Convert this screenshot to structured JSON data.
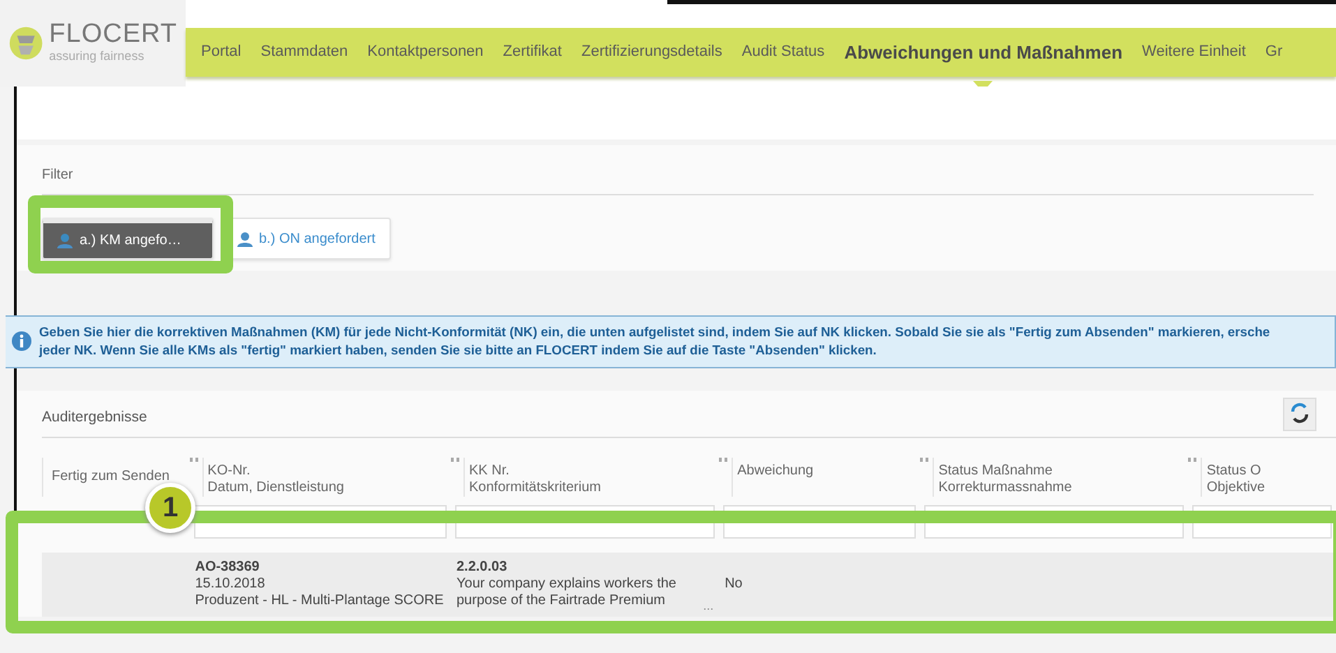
{
  "logo": {
    "name": "FLOCERT",
    "tagline": "assuring fairness"
  },
  "nav": [
    {
      "label": "Portal",
      "selected": false
    },
    {
      "label": "Stammdaten",
      "selected": false
    },
    {
      "label": "Kontaktpersonen",
      "selected": false
    },
    {
      "label": "Zertifikat",
      "selected": false
    },
    {
      "label": "Zertifizierungsdetails",
      "selected": false
    },
    {
      "label": "Audit Status",
      "selected": false
    },
    {
      "label": "Abweichungen und Maßnahmen",
      "selected": true
    },
    {
      "label": "Weitere Einheit",
      "selected": false
    },
    {
      "label": "Gr",
      "selected": false
    }
  ],
  "filter": {
    "title": "Filter",
    "buttons": [
      {
        "label": "a.) KM angefo…",
        "selected": true,
        "highlighted": true
      },
      {
        "label": "b.) ON angefordert",
        "selected": false,
        "highlighted": false
      }
    ]
  },
  "info": [
    "Geben Sie hier die korrektiven Maßnahmen (KM) für jede Nicht-Konformität (NK) ein, die unten aufgelistet sind, indem Sie auf NK klicken. Sobald Sie sie als \"Fertig zum Absenden\" markieren, ersche",
    "jeder NK. Wenn Sie alle KMs als \"fertig\" markiert haben, senden Sie sie bitte an FLOCERT indem Sie auf die Taste \"Absenden\" klicken."
  ],
  "results": {
    "title": "Auditergebnisse",
    "columns": [
      {
        "lines": [
          "Fertig zum Senden"
        ],
        "sortable": false,
        "filterable": false
      },
      {
        "lines": [
          "KO-Nr.",
          "Datum, Dienstleistung"
        ],
        "sortable": true,
        "filterable": true
      },
      {
        "lines": [
          "KK Nr.",
          "Konformitätskriterium"
        ],
        "sortable": true,
        "filterable": true
      },
      {
        "lines": [
          "Abweichung"
        ],
        "sortable": true,
        "filterable": true
      },
      {
        "lines": [
          "Status Maßnahme",
          "Korrekturmassnahme"
        ],
        "sortable": true,
        "filterable": true
      },
      {
        "lines": [
          "Status O",
          "Objektive"
        ],
        "sortable": true,
        "filterable": true
      }
    ],
    "rows": [
      {
        "highlighted": true,
        "cells": [
          {},
          {
            "title": "AO-38369",
            "lines": [
              "15.10.2018",
              "Produzent - HL - Multi-Plantage SCORE"
            ]
          },
          {
            "title": "2.2.0.03",
            "lines": [
              "Your company explains workers the",
              "purpose of the Fairtrade Premium"
            ],
            "more": "..."
          },
          {
            "lines": [
              "No"
            ]
          },
          {},
          {}
        ]
      }
    ],
    "badge": "1"
  }
}
